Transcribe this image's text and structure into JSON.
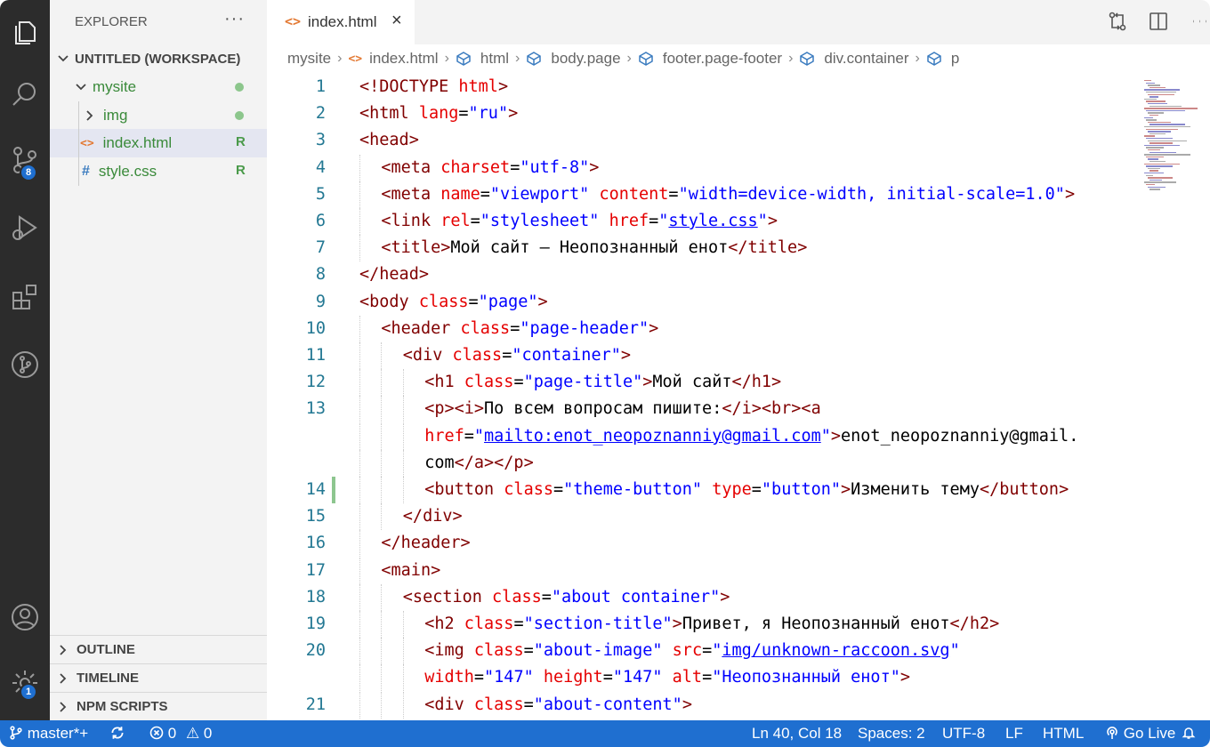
{
  "activity_bar": {
    "items": [
      {
        "icon": "files-icon",
        "active": true
      },
      {
        "icon": "search-icon"
      },
      {
        "icon": "source-control-icon",
        "badge": "8"
      },
      {
        "icon": "run-debug-icon"
      },
      {
        "icon": "extensions-icon"
      },
      {
        "icon": "git-graph-icon"
      }
    ],
    "bottom": [
      {
        "icon": "account-icon"
      },
      {
        "icon": "settings-gear-icon",
        "badge": "1"
      }
    ]
  },
  "explorer": {
    "title": "EXPLORER",
    "more": "···",
    "workspace": "UNTITLED (WORKSPACE)",
    "tree": [
      {
        "name": "mysite",
        "type": "folder",
        "status": "dot"
      },
      {
        "name": "img",
        "type": "folder",
        "status": "dot"
      },
      {
        "name": "index.html",
        "type": "html",
        "icon": "<>",
        "status": "R"
      },
      {
        "name": "style.css",
        "type": "css",
        "icon": "#",
        "status": "R"
      }
    ],
    "panels": [
      "OUTLINE",
      "TIMELINE",
      "NPM SCRIPTS"
    ]
  },
  "tab": {
    "icon": "<>",
    "label": "index.html",
    "close": "×"
  },
  "breadcrumbs": [
    "mysite",
    "index.html",
    "html",
    "body.page",
    "footer.page-footer",
    "div.container",
    "p"
  ],
  "editor": {
    "lines": [
      {
        "n": "1",
        "indent": 0,
        "tokens": [
          [
            "t",
            "<!DOCTYPE "
          ],
          [
            "a",
            "html"
          ],
          [
            "t",
            ">"
          ]
        ]
      },
      {
        "n": "2",
        "indent": 0,
        "tokens": [
          [
            "t",
            "<html "
          ],
          [
            "a",
            "lang"
          ],
          [
            "x",
            "="
          ],
          [
            "v",
            "\"ru\""
          ],
          [
            "t",
            ">"
          ]
        ]
      },
      {
        "n": "3",
        "indent": 0,
        "tokens": [
          [
            "t",
            "<head>"
          ]
        ]
      },
      {
        "n": "4",
        "indent": 1,
        "tokens": [
          [
            "t",
            "<meta "
          ],
          [
            "a",
            "charset"
          ],
          [
            "x",
            "="
          ],
          [
            "v",
            "\"utf-8\""
          ],
          [
            "t",
            ">"
          ]
        ]
      },
      {
        "n": "5",
        "indent": 1,
        "tokens": [
          [
            "t",
            "<meta "
          ],
          [
            "a",
            "name"
          ],
          [
            "x",
            "="
          ],
          [
            "v",
            "\"viewport\" "
          ],
          [
            "a",
            "content"
          ],
          [
            "x",
            "="
          ],
          [
            "v",
            "\"width=device-width, initial-scale=1.0\""
          ],
          [
            "t",
            ">"
          ]
        ]
      },
      {
        "n": "6",
        "indent": 1,
        "tokens": [
          [
            "t",
            "<link "
          ],
          [
            "a",
            "rel"
          ],
          [
            "x",
            "="
          ],
          [
            "v",
            "\"stylesheet\" "
          ],
          [
            "a",
            "href"
          ],
          [
            "x",
            "="
          ],
          [
            "v",
            "\""
          ],
          [
            "u",
            "style.css"
          ],
          [
            "v",
            "\""
          ],
          [
            "t",
            ">"
          ]
        ]
      },
      {
        "n": "7",
        "indent": 1,
        "tokens": [
          [
            "t",
            "<title>"
          ],
          [
            "x",
            "Мой сайт — Неопознанный енот"
          ],
          [
            "t",
            "</title>"
          ]
        ]
      },
      {
        "n": "8",
        "indent": 0,
        "tokens": [
          [
            "t",
            "</head>"
          ]
        ]
      },
      {
        "n": "9",
        "indent": 0,
        "tokens": [
          [
            "t",
            "<body "
          ],
          [
            "a",
            "class"
          ],
          [
            "x",
            "="
          ],
          [
            "v",
            "\"page\""
          ],
          [
            "t",
            ">"
          ]
        ]
      },
      {
        "n": "10",
        "indent": 1,
        "tokens": [
          [
            "t",
            "<header "
          ],
          [
            "a",
            "class"
          ],
          [
            "x",
            "="
          ],
          [
            "v",
            "\"page-header\""
          ],
          [
            "t",
            ">"
          ]
        ]
      },
      {
        "n": "11",
        "indent": 2,
        "tokens": [
          [
            "t",
            "<div "
          ],
          [
            "a",
            "class"
          ],
          [
            "x",
            "="
          ],
          [
            "v",
            "\"container\""
          ],
          [
            "t",
            ">"
          ]
        ]
      },
      {
        "n": "12",
        "indent": 3,
        "tokens": [
          [
            "t",
            "<h1 "
          ],
          [
            "a",
            "class"
          ],
          [
            "x",
            "="
          ],
          [
            "v",
            "\"page-title\""
          ],
          [
            "t",
            ">"
          ],
          [
            "x",
            "Мой сайт"
          ],
          [
            "t",
            "</h1>"
          ]
        ]
      },
      {
        "n": "13",
        "indent": 3,
        "tokens": [
          [
            "t",
            "<p><i>"
          ],
          [
            "x",
            "По всем вопросам пишите:"
          ],
          [
            "t",
            "</i><br><a"
          ]
        ]
      },
      {
        "n": "",
        "indent": 3,
        "tokens": [
          [
            "a",
            "href"
          ],
          [
            "x",
            "="
          ],
          [
            "v",
            "\""
          ],
          [
            "u",
            "mailto:enot_neopoznanniy@gmail.com"
          ],
          [
            "v",
            "\""
          ],
          [
            "t",
            ">"
          ],
          [
            "x",
            "enot_neopoznanniy@gmail."
          ]
        ]
      },
      {
        "n": "",
        "indent": 3,
        "tokens": [
          [
            "x",
            "com"
          ],
          [
            "t",
            "</a></p>"
          ]
        ]
      },
      {
        "n": "14",
        "indent": 3,
        "mod": true,
        "tokens": [
          [
            "t",
            "<button "
          ],
          [
            "a",
            "class"
          ],
          [
            "x",
            "="
          ],
          [
            "v",
            "\"theme-button\" "
          ],
          [
            "a",
            "type"
          ],
          [
            "x",
            "="
          ],
          [
            "v",
            "\"button\""
          ],
          [
            "t",
            ">"
          ],
          [
            "x",
            "Изменить тему"
          ],
          [
            "t",
            "</button>"
          ]
        ]
      },
      {
        "n": "15",
        "indent": 2,
        "tokens": [
          [
            "t",
            "</div>"
          ]
        ]
      },
      {
        "n": "16",
        "indent": 1,
        "tokens": [
          [
            "t",
            "</header>"
          ]
        ]
      },
      {
        "n": "17",
        "indent": 1,
        "tokens": [
          [
            "t",
            "<main>"
          ]
        ]
      },
      {
        "n": "18",
        "indent": 2,
        "tokens": [
          [
            "t",
            "<section "
          ],
          [
            "a",
            "class"
          ],
          [
            "x",
            "="
          ],
          [
            "v",
            "\"about container\""
          ],
          [
            "t",
            ">"
          ]
        ]
      },
      {
        "n": "19",
        "indent": 3,
        "tokens": [
          [
            "t",
            "<h2 "
          ],
          [
            "a",
            "class"
          ],
          [
            "x",
            "="
          ],
          [
            "v",
            "\"section-title\""
          ],
          [
            "t",
            ">"
          ],
          [
            "x",
            "Привет, я Неопознанный енот"
          ],
          [
            "t",
            "</h2>"
          ]
        ]
      },
      {
        "n": "20",
        "indent": 3,
        "tokens": [
          [
            "t",
            "<img "
          ],
          [
            "a",
            "class"
          ],
          [
            "x",
            "="
          ],
          [
            "v",
            "\"about-image\" "
          ],
          [
            "a",
            "src"
          ],
          [
            "x",
            "="
          ],
          [
            "v",
            "\""
          ],
          [
            "u",
            "img/unknown-raccoon.svg"
          ],
          [
            "v",
            "\""
          ]
        ]
      },
      {
        "n": "",
        "indent": 3,
        "tokens": [
          [
            "a",
            "width"
          ],
          [
            "x",
            "="
          ],
          [
            "v",
            "\"147\" "
          ],
          [
            "a",
            "height"
          ],
          [
            "x",
            "="
          ],
          [
            "v",
            "\"147\" "
          ],
          [
            "a",
            "alt"
          ],
          [
            "x",
            "="
          ],
          [
            "v",
            "\"Неопознанный енот\""
          ],
          [
            "t",
            ">"
          ]
        ]
      },
      {
        "n": "21",
        "indent": 3,
        "tokens": [
          [
            "t",
            "<div "
          ],
          [
            "a",
            "class"
          ],
          [
            "x",
            "="
          ],
          [
            "v",
            "\"about-content\""
          ],
          [
            "t",
            ">"
          ]
        ]
      }
    ]
  },
  "status": {
    "branch": "master*+",
    "problems_errors": "0",
    "problems_warnings": "0",
    "position": "Ln 40, Col 18",
    "spaces": "Spaces: 2",
    "encoding": "UTF-8",
    "eol": "LF",
    "language": "HTML",
    "golive": "Go Live"
  }
}
